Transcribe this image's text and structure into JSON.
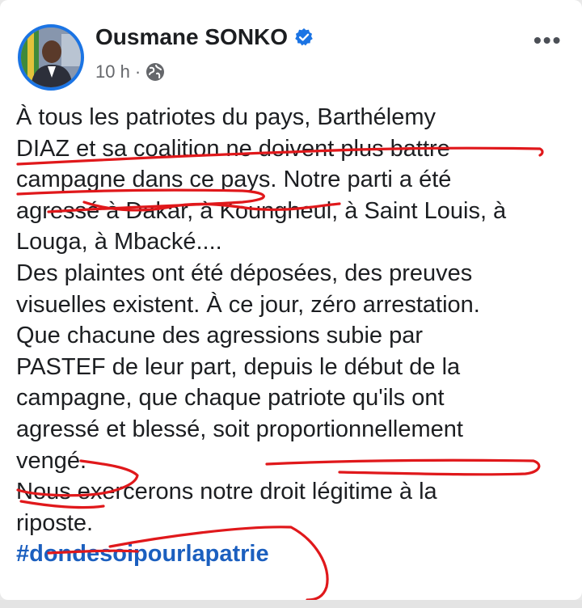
{
  "post": {
    "author": "Ousmane SONKO",
    "time": "10 h",
    "separator": "·",
    "verified_icon": "verified-badge-icon",
    "privacy_icon": "globe-icon",
    "more_label": "•••",
    "lines": [
      "À tous les patriotes du pays, Barthélemy",
      "DIAZ et sa coalition ne doivent plus battre",
      "campagne dans ce pays. Notre parti a été",
      "agressé à Dakar, à Koungheul, à Saint Louis, à",
      "Louga, à Mbacké....",
      "Des plaintes ont été déposées, des preuves",
      "visuelles existent. À ce jour, zéro arrestation.",
      "Que chacune des agressions subie par",
      "PASTEF de leur part, depuis le début de la",
      "campagne, que chaque patriote qu'ils ont",
      "agressé et blessé, soit proportionnellement",
      "vengé.",
      "Nous exercerons notre droit légitime à la",
      "riposte."
    ],
    "hashtag": "#dondesoipourlapatrie"
  },
  "colors": {
    "accent": "#1b74e4",
    "hashtag": "#1b5fbf",
    "annotation": "#e0181b"
  }
}
